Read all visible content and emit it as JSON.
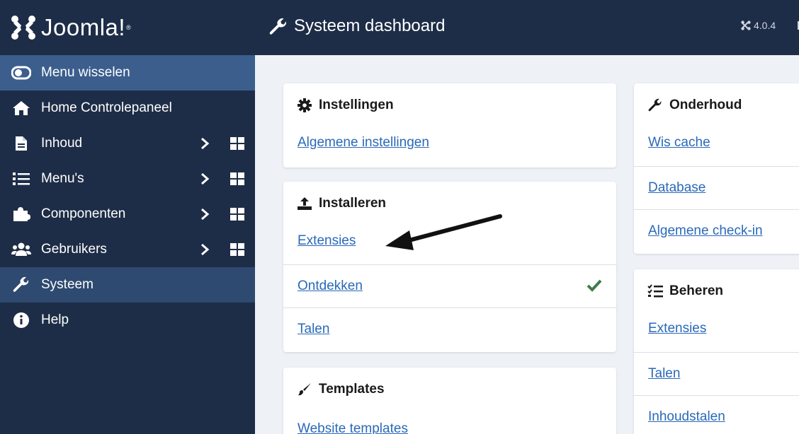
{
  "app": {
    "logo_text": "Joomla!",
    "version": "4.0.4"
  },
  "header": {
    "title": "Systeem dashboard"
  },
  "sidebar": {
    "items": [
      {
        "label": "Menu wisselen",
        "icon": "toggle-icon"
      },
      {
        "label": "Home Controlepaneel",
        "icon": "home-icon"
      },
      {
        "label": "Inhoud",
        "icon": "file-icon"
      },
      {
        "label": "Menu's",
        "icon": "list-icon"
      },
      {
        "label": "Componenten",
        "icon": "puzzle-icon"
      },
      {
        "label": "Gebruikers",
        "icon": "users-icon"
      },
      {
        "label": "Systeem",
        "icon": "wrench-icon"
      },
      {
        "label": "Help",
        "icon": "info-icon"
      }
    ]
  },
  "cards": {
    "instellingen": {
      "title": "Instellingen",
      "links": [
        "Algemene instellingen"
      ]
    },
    "installeren": {
      "title": "Installeren",
      "links": [
        "Extensies",
        "Ontdekken",
        "Talen"
      ]
    },
    "templates": {
      "title": "Templates",
      "links": [
        "Website templates"
      ]
    },
    "onderhoud": {
      "title": "Onderhoud",
      "links": [
        "Wis cache",
        "Database",
        "Algemene check-in"
      ]
    },
    "beheren": {
      "title": "Beheren",
      "links": [
        "Extensies",
        "Talen",
        "Inhoudstalen"
      ]
    }
  },
  "colors": {
    "sidebar_bg": "#1e2d47",
    "link": "#2a69b8",
    "check": "#3f7d4c",
    "active": "#2e4a70"
  }
}
